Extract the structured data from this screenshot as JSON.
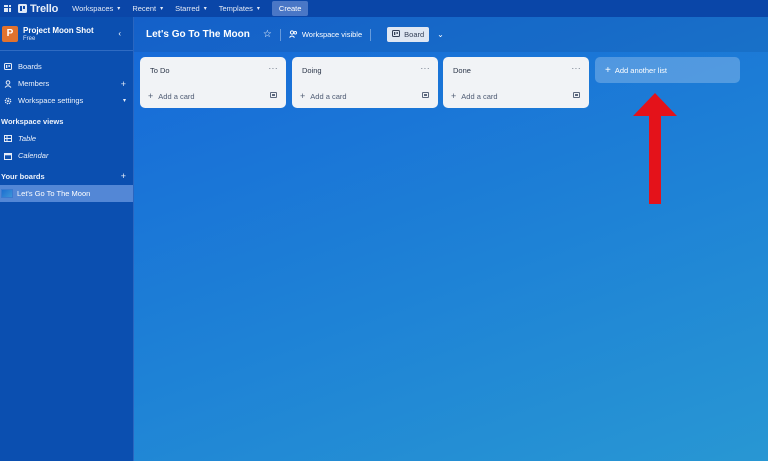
{
  "topnav": {
    "logo_text": "Trello",
    "items": [
      {
        "label": "Workspaces"
      },
      {
        "label": "Recent"
      },
      {
        "label": "Starred"
      },
      {
        "label": "Templates"
      }
    ],
    "create_label": "Create"
  },
  "sidebar": {
    "workspace": {
      "avatar_letter": "P",
      "name": "Project Moon Shot",
      "plan": "Free",
      "avatar_color": "#e1722e"
    },
    "items": [
      {
        "label": "Boards",
        "icon": "board-icon"
      },
      {
        "label": "Members",
        "icon": "person-icon"
      },
      {
        "label": "Workspace settings",
        "icon": "gear-icon"
      }
    ],
    "views_header": "Workspace views",
    "views": [
      {
        "label": "Table",
        "icon": "table-icon"
      },
      {
        "label": "Calendar",
        "icon": "calendar-icon"
      }
    ],
    "boards_header": "Your boards",
    "boards": [
      {
        "label": "Let's Go To The Moon"
      }
    ]
  },
  "board": {
    "title": "Let's Go To The Moon",
    "visibility_label": "Workspace visible",
    "view_label": "Board",
    "lists": [
      {
        "title": "To Do",
        "add_card_label": "Add a card"
      },
      {
        "title": "Doing",
        "add_card_label": "Add a card"
      },
      {
        "title": "Done",
        "add_card_label": "Add a card"
      }
    ],
    "add_list_label": "Add another list"
  },
  "annotation": {
    "arrow_color": "#e4121a"
  }
}
